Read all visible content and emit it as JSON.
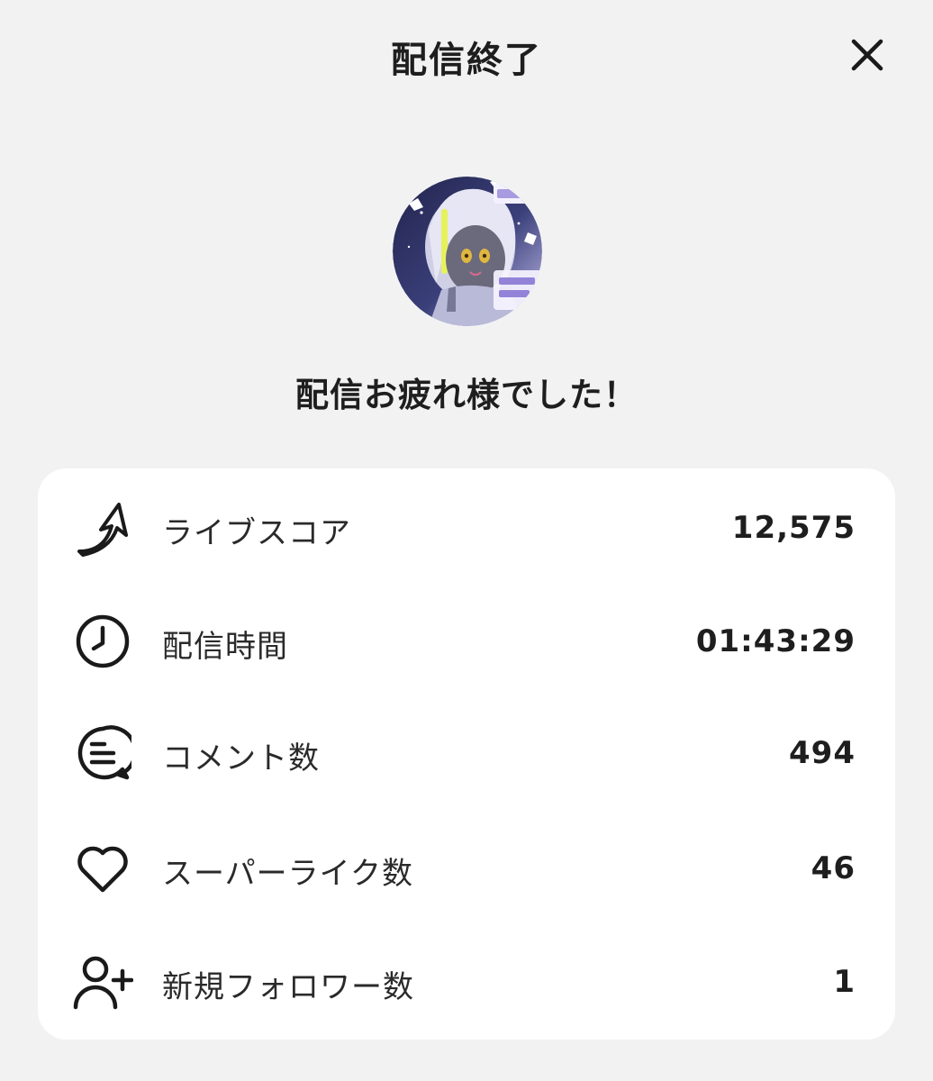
{
  "header": {
    "title": "配信終了",
    "close_icon": "close-icon"
  },
  "avatar": {
    "icon": "streamer-avatar"
  },
  "message": "配信お疲れ様でした！",
  "stats": [
    {
      "icon": "live-score-arrow-icon",
      "label": "ライブスコア",
      "value": "12,575"
    },
    {
      "icon": "clock-icon",
      "label": "配信時間",
      "value": "01:43:29"
    },
    {
      "icon": "comment-bubble-icon",
      "label": "コメント数",
      "value": "494"
    },
    {
      "icon": "heart-icon",
      "label": "スーパーライク数",
      "value": "46"
    },
    {
      "icon": "add-user-icon",
      "label": "新規フォロワー数",
      "value": "1"
    }
  ],
  "colors": {
    "background": "#f2f2f3",
    "card": "#ffffff",
    "text": "#1e1e1e",
    "icon_stroke": "#1a1a1a"
  }
}
